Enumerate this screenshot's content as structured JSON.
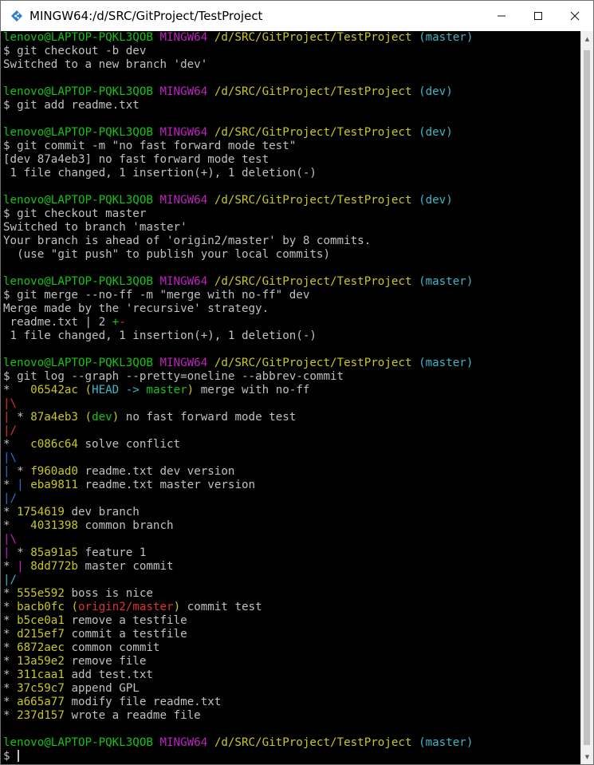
{
  "window": {
    "title": "MINGW64:/d/SRC/GitProject/TestProject",
    "minimize_icon": "minimize-icon",
    "maximize_icon": "maximize-icon",
    "close_icon": "close-icon"
  },
  "colors": {
    "user": "#13c413",
    "mingw": "#c020c0",
    "path": "#c8c820",
    "branch": "#3ab8c8",
    "text": "#c0c0c0",
    "hash": "#c8c820",
    "head": "#3ab8c8",
    "dev": "#13c413",
    "remote": "#e03030",
    "graph_red": "#e03030",
    "graph_green": "#13c413",
    "graph_magenta": "#c020c0",
    "graph_blue": "#2a6fd6",
    "graph_cyan": "#3ab8c8"
  },
  "terminal": {
    "lines": [
      [
        [
          "lenovo@LAPTOP-PQKL3QOB ",
          "user"
        ],
        [
          "MINGW64 ",
          "mingw"
        ],
        [
          "/d/SRC/GitProject/TestProject ",
          "path"
        ],
        [
          "(master)",
          "branch"
        ]
      ],
      [
        [
          "$ git checkout -b dev",
          "text"
        ]
      ],
      [
        [
          "Switched to a new branch 'dev'",
          "text"
        ]
      ],
      [
        [
          "",
          "text"
        ]
      ],
      [
        [
          "lenovo@LAPTOP-PQKL3QOB ",
          "user"
        ],
        [
          "MINGW64 ",
          "mingw"
        ],
        [
          "/d/SRC/GitProject/TestProject ",
          "path"
        ],
        [
          "(dev)",
          "branch"
        ]
      ],
      [
        [
          "$ git add readme.txt",
          "text"
        ]
      ],
      [
        [
          "",
          "text"
        ]
      ],
      [
        [
          "lenovo@LAPTOP-PQKL3QOB ",
          "user"
        ],
        [
          "MINGW64 ",
          "mingw"
        ],
        [
          "/d/SRC/GitProject/TestProject ",
          "path"
        ],
        [
          "(dev)",
          "branch"
        ]
      ],
      [
        [
          "$ git commit -m \"no fast forward mode test\"",
          "text"
        ]
      ],
      [
        [
          "[dev 87a4eb3] no fast forward mode test",
          "text"
        ]
      ],
      [
        [
          " 1 file changed, 1 insertion(+), 1 deletion(-)",
          "text"
        ]
      ],
      [
        [
          "",
          "text"
        ]
      ],
      [
        [
          "lenovo@LAPTOP-PQKL3QOB ",
          "user"
        ],
        [
          "MINGW64 ",
          "mingw"
        ],
        [
          "/d/SRC/GitProject/TestProject ",
          "path"
        ],
        [
          "(dev)",
          "branch"
        ]
      ],
      [
        [
          "$ git checkout master",
          "text"
        ]
      ],
      [
        [
          "Switched to branch 'master'",
          "text"
        ]
      ],
      [
        [
          "Your branch is ahead of 'origin2/master' by 8 commits.",
          "text"
        ]
      ],
      [
        [
          "  (use \"git push\" to publish your local commits)",
          "text"
        ]
      ],
      [
        [
          "",
          "text"
        ]
      ],
      [
        [
          "lenovo@LAPTOP-PQKL3QOB ",
          "user"
        ],
        [
          "MINGW64 ",
          "mingw"
        ],
        [
          "/d/SRC/GitProject/TestProject ",
          "path"
        ],
        [
          "(master)",
          "branch"
        ]
      ],
      [
        [
          "$ git merge --no-ff -m \"merge with no-ff\" dev",
          "text"
        ]
      ],
      [
        [
          "Merge made by the 'recursive' strategy.",
          "text"
        ]
      ],
      [
        [
          " readme.txt | 2 ",
          "text"
        ],
        [
          "+",
          "graph_green"
        ],
        [
          "-",
          "graph_red"
        ]
      ],
      [
        [
          " 1 file changed, 1 insertion(+), 1 deletion(-)",
          "text"
        ]
      ],
      [
        [
          "",
          "text"
        ]
      ],
      [
        [
          "lenovo@LAPTOP-PQKL3QOB ",
          "user"
        ],
        [
          "MINGW64 ",
          "mingw"
        ],
        [
          "/d/SRC/GitProject/TestProject ",
          "path"
        ],
        [
          "(master)",
          "branch"
        ]
      ],
      [
        [
          "$ git log --graph --pretty=oneline --abbrev-commit",
          "text"
        ]
      ],
      [
        [
          "*   ",
          "text"
        ],
        [
          "06542ac ",
          "hash"
        ],
        [
          "(",
          "hash"
        ],
        [
          "HEAD -> ",
          "head"
        ],
        [
          "master",
          "dev"
        ],
        [
          ")",
          "hash"
        ],
        [
          " merge with no-ff",
          "text"
        ]
      ],
      [
        [
          "|\\",
          "graph_red"
        ]
      ],
      [
        [
          "| ",
          "graph_red"
        ],
        [
          "* ",
          "text"
        ],
        [
          "87a4eb3 ",
          "hash"
        ],
        [
          "(",
          "hash"
        ],
        [
          "dev",
          "dev"
        ],
        [
          ")",
          "hash"
        ],
        [
          " no fast forward mode test",
          "text"
        ]
      ],
      [
        [
          "|/",
          "graph_red"
        ]
      ],
      [
        [
          "*   ",
          "text"
        ],
        [
          "c086c64 ",
          "hash"
        ],
        [
          "solve conflict",
          "text"
        ]
      ],
      [
        [
          "|\\",
          "graph_blue"
        ]
      ],
      [
        [
          "| ",
          "graph_blue"
        ],
        [
          "* ",
          "text"
        ],
        [
          "f960ad0 ",
          "hash"
        ],
        [
          "readme.txt dev version",
          "text"
        ]
      ],
      [
        [
          "* ",
          "text"
        ],
        [
          "| ",
          "graph_blue"
        ],
        [
          "eba9811 ",
          "hash"
        ],
        [
          "readme.txt master version",
          "text"
        ]
      ],
      [
        [
          "|/",
          "graph_blue"
        ]
      ],
      [
        [
          "* ",
          "text"
        ],
        [
          "1754619 ",
          "hash"
        ],
        [
          "dev branch",
          "text"
        ]
      ],
      [
        [
          "*   ",
          "text"
        ],
        [
          "4031398 ",
          "hash"
        ],
        [
          "common branch",
          "text"
        ]
      ],
      [
        [
          "|\\",
          "graph_magenta"
        ]
      ],
      [
        [
          "| ",
          "graph_magenta"
        ],
        [
          "* ",
          "text"
        ],
        [
          "85a91a5 ",
          "hash"
        ],
        [
          "feature 1",
          "text"
        ]
      ],
      [
        [
          "* ",
          "text"
        ],
        [
          "| ",
          "graph_magenta"
        ],
        [
          "8dd772b ",
          "hash"
        ],
        [
          "master commit",
          "text"
        ]
      ],
      [
        [
          "|/",
          "graph_cyan"
        ]
      ],
      [
        [
          "* ",
          "text"
        ],
        [
          "555e592 ",
          "hash"
        ],
        [
          "boss is nice",
          "text"
        ]
      ],
      [
        [
          "* ",
          "text"
        ],
        [
          "bacb0fc ",
          "hash"
        ],
        [
          "(",
          "hash"
        ],
        [
          "origin2/master",
          "remote"
        ],
        [
          ")",
          "hash"
        ],
        [
          " commit test",
          "text"
        ]
      ],
      [
        [
          "* ",
          "text"
        ],
        [
          "b5ce0a1 ",
          "hash"
        ],
        [
          "remove a testfile",
          "text"
        ]
      ],
      [
        [
          "* ",
          "text"
        ],
        [
          "d215ef7 ",
          "hash"
        ],
        [
          "commit a testfile",
          "text"
        ]
      ],
      [
        [
          "* ",
          "text"
        ],
        [
          "6872aec ",
          "hash"
        ],
        [
          "common commit",
          "text"
        ]
      ],
      [
        [
          "* ",
          "text"
        ],
        [
          "13a59e2 ",
          "hash"
        ],
        [
          "remove file",
          "text"
        ]
      ],
      [
        [
          "* ",
          "text"
        ],
        [
          "311caa1 ",
          "hash"
        ],
        [
          "add test.txt",
          "text"
        ]
      ],
      [
        [
          "* ",
          "text"
        ],
        [
          "37c59c7 ",
          "hash"
        ],
        [
          "append GPL",
          "text"
        ]
      ],
      [
        [
          "* ",
          "text"
        ],
        [
          "a665a77 ",
          "hash"
        ],
        [
          "modify file readme.txt",
          "text"
        ]
      ],
      [
        [
          "* ",
          "text"
        ],
        [
          "237d157 ",
          "hash"
        ],
        [
          "wrote a readme file",
          "text"
        ]
      ],
      [
        [
          "",
          "text"
        ]
      ],
      [
        [
          "lenovo@LAPTOP-PQKL3QOB ",
          "user"
        ],
        [
          "MINGW64 ",
          "mingw"
        ],
        [
          "/d/SRC/GitProject/TestProject ",
          "path"
        ],
        [
          "(master)",
          "branch"
        ]
      ],
      [
        [
          "$ ",
          "text"
        ]
      ]
    ]
  }
}
